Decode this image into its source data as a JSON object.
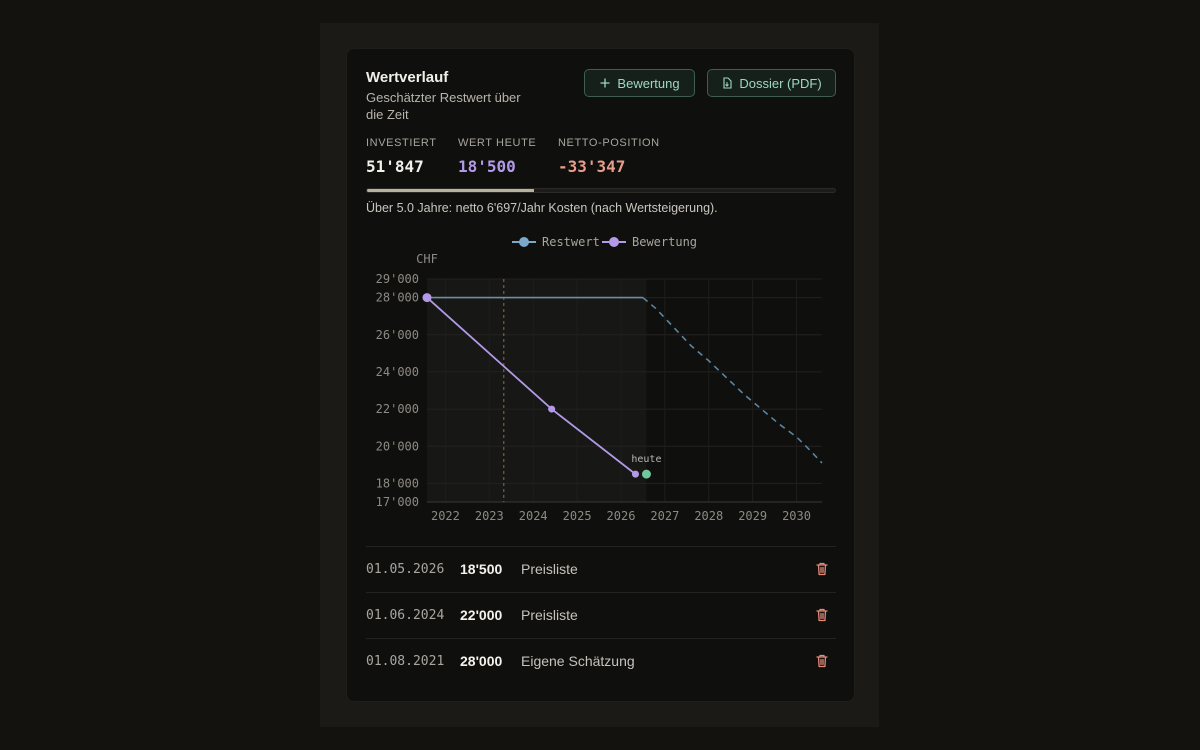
{
  "card": {
    "title": "Wertverlauf",
    "subtitle": "Geschätzter Restwert über die Zeit",
    "buttons": {
      "bewertung": "Bewertung",
      "dossier": "Dossier (PDF)"
    }
  },
  "stats": {
    "invested_label": "INVESTIERT",
    "invested_value": "51'847",
    "today_label": "WERT HEUTE",
    "today_value": "18'500",
    "net_label": "NETTO-POSITION",
    "net_value": "-33'347",
    "progress_fraction": 0.357
  },
  "summary": "Über 5.0 Jahre: netto 6'697/Jahr Kosten (nach Wertsteigerung).",
  "colors": {
    "restwert": "#7ba9c9",
    "restwert_forecast": "#5b84a0",
    "bewertung": "#b39ae8",
    "today": "#6fc79a",
    "net": "#e79d8c",
    "marker": "#9a6a3c",
    "trash": "#e28c7c"
  },
  "chart_data": {
    "type": "line",
    "ylabel": "CHF",
    "xlim": [
      2021.58,
      2030.58
    ],
    "ylim": [
      17000,
      29000
    ],
    "x_ticks": [
      2022,
      2023,
      2024,
      2025,
      2026,
      2027,
      2028,
      2029,
      2030
    ],
    "y_ticks": [
      17000,
      18000,
      20000,
      22000,
      24000,
      26000,
      28000,
      29000
    ],
    "y_tick_labels": [
      "17'000",
      "18'000",
      "20'000",
      "22'000",
      "24'000",
      "26'000",
      "28'000",
      "29'000"
    ],
    "x_tick_labels": [
      "2022",
      "2023",
      "2024",
      "2025",
      "2026",
      "2027",
      "2028",
      "2029",
      "2030"
    ],
    "legend": [
      "Restwert",
      "Bewertung"
    ],
    "legend_position": "top",
    "today_label": "heute",
    "today_x": 2026.58,
    "marker_x": 2023.33,
    "shaded_range": [
      2021.58,
      2026.58
    ],
    "series": [
      {
        "name": "Restwert",
        "style": "solid",
        "x": [
          2021.58,
          2026.5
        ],
        "y": [
          28000,
          28000
        ]
      },
      {
        "name": "Restwert",
        "style": "dashed",
        "x": [
          2026.5,
          2026.8,
          2027.2,
          2027.6,
          2028,
          2028.4,
          2028.8,
          2029.2,
          2029.6,
          2030,
          2030.3,
          2030.58
        ],
        "y": [
          28000,
          27400,
          26400,
          25400,
          24600,
          23700,
          22800,
          22000,
          21200,
          20500,
          19800,
          19100
        ]
      },
      {
        "name": "Bewertung",
        "style": "solid",
        "x": [
          2021.58,
          2024.42,
          2026.33
        ],
        "y": [
          28000,
          22000,
          18500
        ]
      }
    ],
    "today_point": {
      "x": 2026.58,
      "y": 18500
    }
  },
  "entries": [
    {
      "date": "01.05.2026",
      "value": "18'500",
      "source": "Preisliste"
    },
    {
      "date": "01.06.2024",
      "value": "22'000",
      "source": "Preisliste"
    },
    {
      "date": "01.08.2021",
      "value": "28'000",
      "source": "Eigene Schätzung"
    }
  ]
}
